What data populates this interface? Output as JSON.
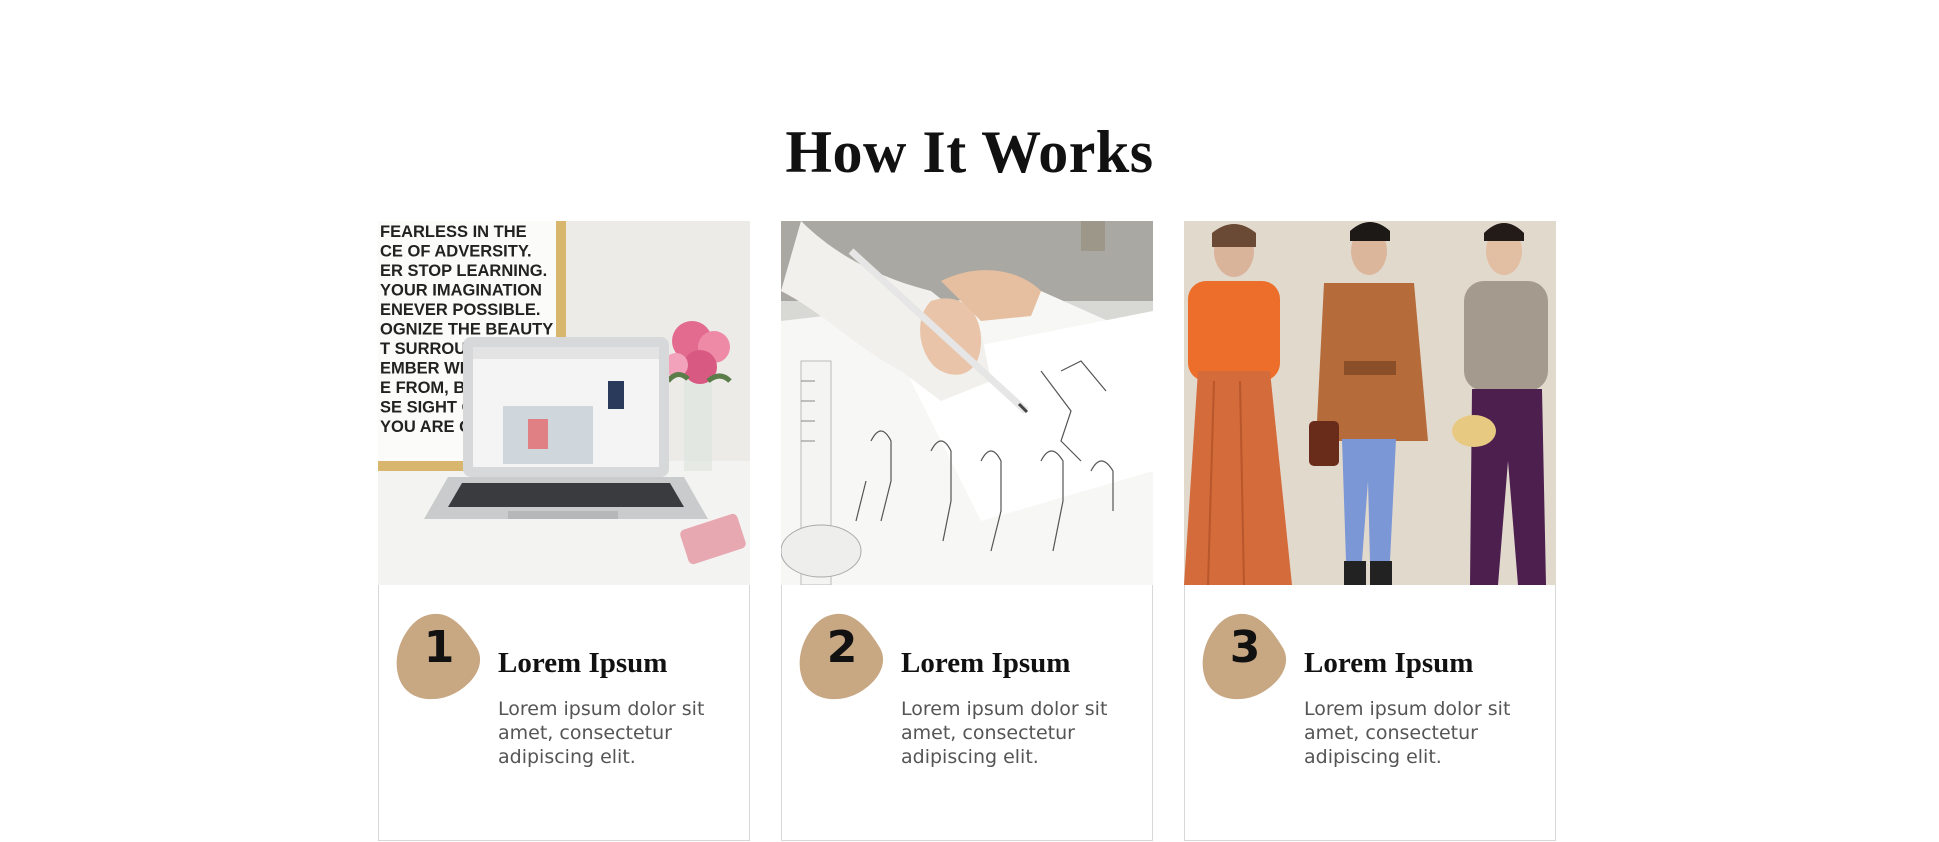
{
  "section": {
    "title": "How It Works"
  },
  "accent_color": "#c8a783",
  "steps": [
    {
      "number": "1",
      "heading": "Lorem Ipsum",
      "text": "Lorem ipsum dolor sit amet, consectetur adipiscing elit.",
      "image": "laptop-desk-photo",
      "poster_lines": [
        "FEARLESS IN THE",
        "CE OF ADVERSITY.",
        "ER STOP LEARNING.",
        "YOUR IMAGINATION",
        "ENEVER POSSIBLE.",
        "OGNIZE THE BEAUTY",
        "T SURROUNDS",
        "EMBER WHERE",
        "E FROM, BUT",
        "SE SIGHT OF",
        "YOU ARE GO"
      ]
    },
    {
      "number": "2",
      "heading": "Lorem Ipsum",
      "text": "Lorem ipsum dolor sit amet, consectetur adipiscing elit.",
      "image": "fashion-sketching-photo"
    },
    {
      "number": "3",
      "heading": "Lorem Ipsum",
      "text": "Lorem ipsum dolor sit amet, consectetur adipiscing elit.",
      "image": "fashion-models-photo"
    }
  ]
}
